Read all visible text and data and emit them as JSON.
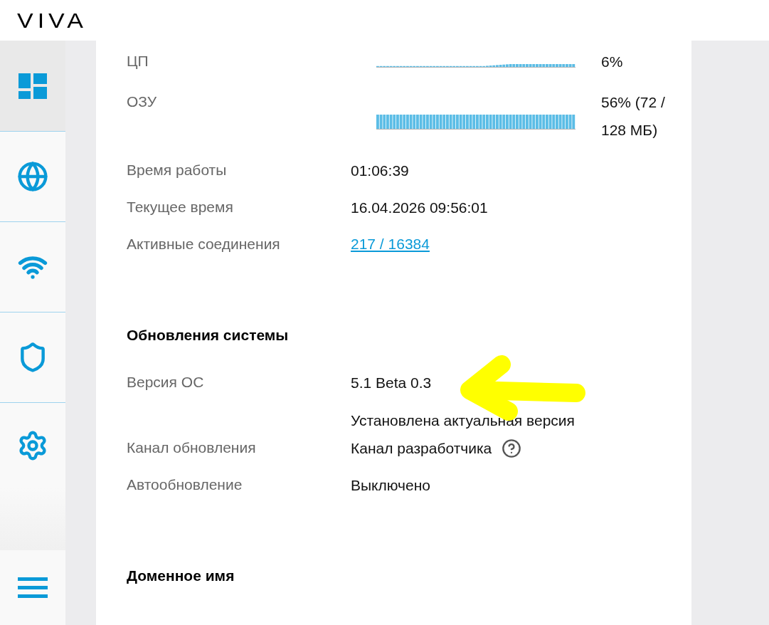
{
  "header": {
    "logo": "VIVA"
  },
  "sidebar": {
    "items": [
      {
        "kind": "dashboard",
        "selected": true
      },
      {
        "kind": "globe",
        "selected": false
      },
      {
        "kind": "wifi",
        "selected": false
      },
      {
        "kind": "shield",
        "selected": false
      },
      {
        "kind": "settings",
        "selected": false
      }
    ],
    "menu": {
      "kind": "menu"
    }
  },
  "system": {
    "metrics": [
      {
        "kind": "cpu",
        "label": "ЦП",
        "value": "6%"
      },
      {
        "kind": "ram",
        "label": "ОЗУ",
        "value": "56% (72 / 128 МБ)"
      }
    ],
    "rows": [
      {
        "label": "Время работы",
        "values": [
          "01:06:39"
        ],
        "kind": "text"
      },
      {
        "label": "Текущее время",
        "values": [
          "16.04.2026 09:56:01"
        ],
        "kind": "text"
      },
      {
        "label": "Активные соединения",
        "values": [
          "217 / 16384"
        ],
        "kind": "link"
      }
    ]
  },
  "updates": {
    "title": "Обновления системы",
    "rows": [
      {
        "label": "Версия ОС",
        "values": [
          "5.1 Beta 0.3",
          "Установлена актуальная версия"
        ]
      },
      {
        "label": "Канал обновления",
        "values": [
          "Канал разработчика"
        ],
        "trailing_icon": {
          "kind": "help"
        }
      },
      {
        "label": "Автообновление",
        "values": [
          "Выключено"
        ]
      }
    ]
  },
  "domain": {
    "title": "Доменное имя"
  },
  "annotation": {
    "kind": "arrow",
    "color": "#ffff00"
  }
}
